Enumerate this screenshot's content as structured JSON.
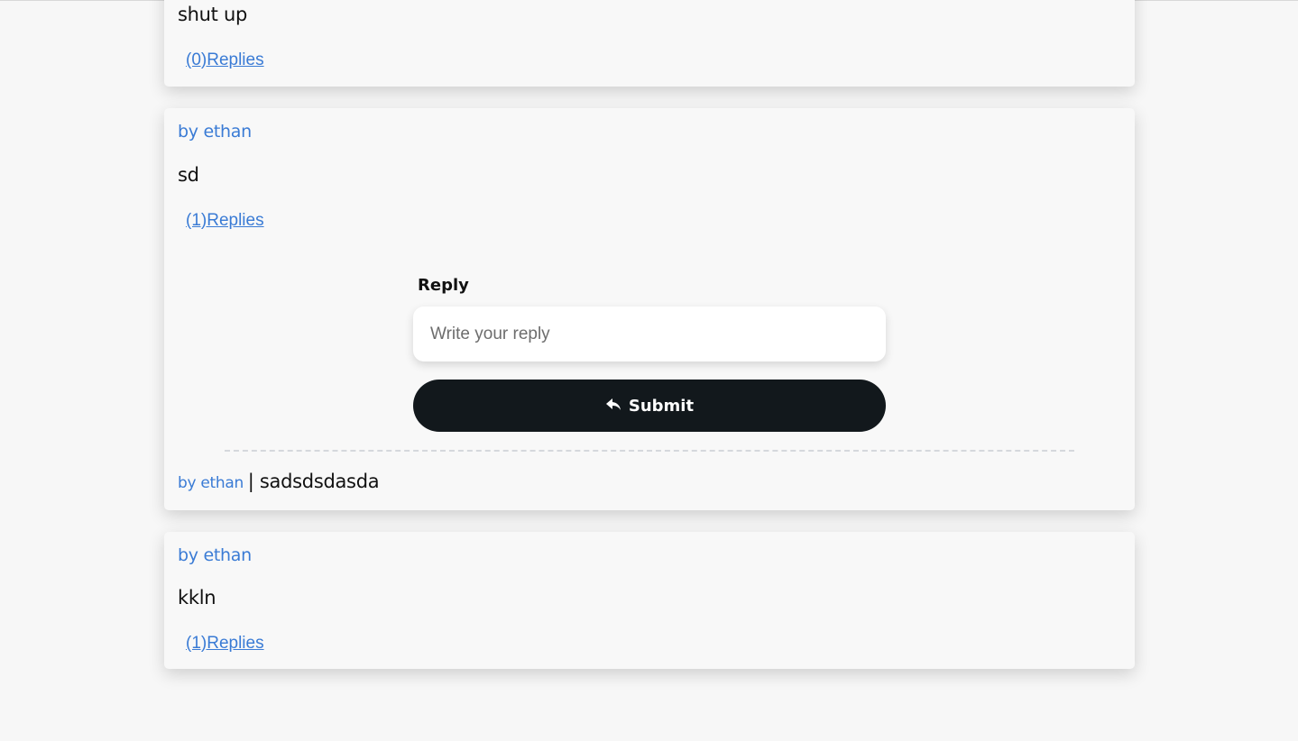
{
  "comments": [
    {
      "body": "shut up",
      "replies_label": "(0)Replies"
    },
    {
      "author": "by ethan",
      "body": "sd",
      "replies_label": "(1)Replies",
      "reply_form": {
        "label": "Reply",
        "placeholder": "Write your reply",
        "submit_label": "Submit",
        "submit_icon": "reply-arrow-icon"
      },
      "replies": [
        {
          "author": "by ethan",
          "separator": "|",
          "text": "sadsdsdasda"
        }
      ]
    },
    {
      "author": "by ethan",
      "body": "kkln",
      "replies_label": "(1)Replies"
    }
  ],
  "colors": {
    "link": "#3a7bd5",
    "submit_bg": "#12181c",
    "page_bg": "#f7f7f7"
  }
}
